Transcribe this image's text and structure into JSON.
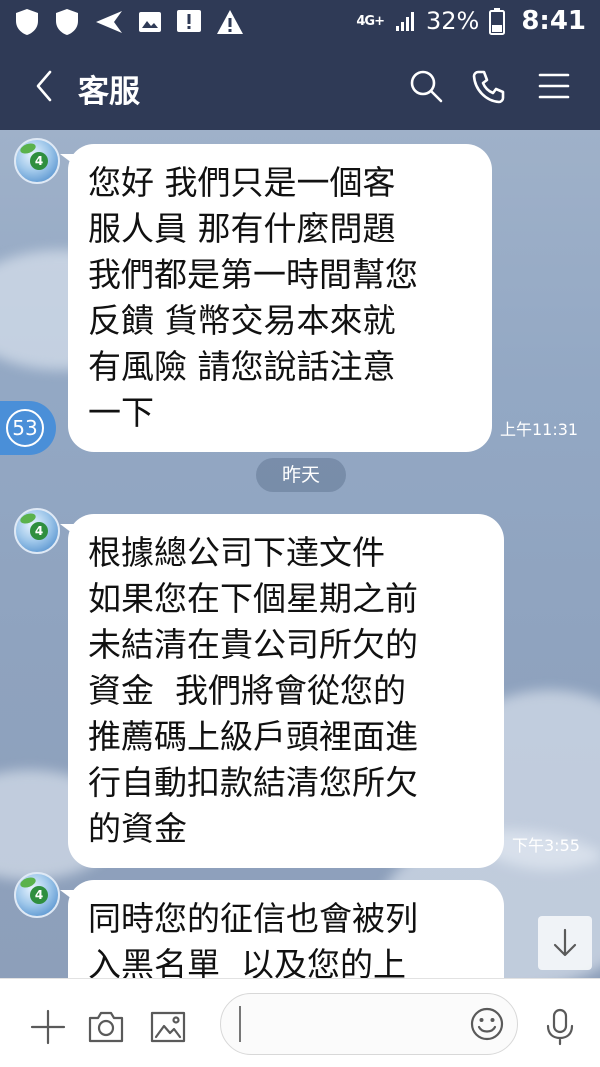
{
  "status_bar": {
    "network": "4G+",
    "battery_percent": "32%",
    "time": "8:41",
    "icons": [
      "shield-icon",
      "shield-icon",
      "send-icon",
      "image-icon",
      "alert-box-icon",
      "warning-icon",
      "signal-icon",
      "battery-icon"
    ]
  },
  "header": {
    "title": "客服",
    "icons": [
      "back-chevron-icon",
      "search-icon",
      "phone-icon",
      "menu-icon"
    ]
  },
  "unread_count": "53",
  "date_separator": "昨天",
  "messages": [
    {
      "text": "您好 我們只是一個客\n服人員 那有什麼問題\n我們都是第一時間幫您\n反饋 貨幣交易本來就\n有風險 請您說話注意\n一下",
      "time": "上午11:31"
    },
    {
      "text": "根據總公司下達文件\n如果您在下個星期之前\n未結清在貴公司所欠的\n資金  我們將會從您的\n推薦碼上級戶頭裡面進\n行自動扣款結清您所欠\n的資金",
      "time": "下午3:55"
    },
    {
      "text": "同時您的征信也會被列\n入黑名單  以及您的上",
      "time": ""
    }
  ],
  "input_bar": {
    "placeholder": "",
    "icons": [
      "plus-icon",
      "camera-icon",
      "image-icon",
      "emoji-icon",
      "microphone-icon"
    ]
  },
  "colors": {
    "header_bg": "#2f3a56",
    "chat_bg": "#93a8c4",
    "bubble_bg": "#ffffff",
    "unread_badge": "#4a8fd8"
  }
}
